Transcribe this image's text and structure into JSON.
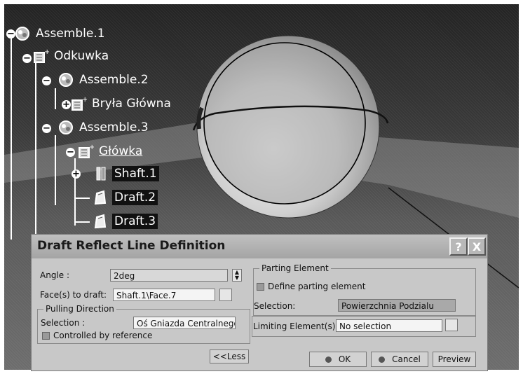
{
  "tree": {
    "nodes": [
      {
        "label": "Assemble.1",
        "icon": "assembly-icon"
      },
      {
        "label": "Odkuwka",
        "icon": "part-body-icon"
      },
      {
        "label": "Assemble.2",
        "icon": "assembly-icon"
      },
      {
        "label": "Bryła Główna",
        "icon": "part-body-icon"
      },
      {
        "label": "Assemble.3",
        "icon": "assembly-icon"
      },
      {
        "label": "Główka",
        "icon": "part-body-icon"
      },
      {
        "label": "Shaft.1",
        "icon": "shaft-icon"
      },
      {
        "label": "Draft.2",
        "icon": "draft-icon"
      },
      {
        "label": "Draft.3",
        "icon": "draft-icon"
      }
    ]
  },
  "dialog": {
    "title": "Draft Reflect Line Definition",
    "help_button": "?",
    "close_button": "X",
    "angle_label": "Angle :",
    "angle_value": "2deg",
    "faces_label": "Face(s) to draft:",
    "faces_value": "Shaft.1\\Face.7",
    "pulling_direction": {
      "title": "Pulling Direction",
      "selection_label": "Selection :",
      "selection_value": "Oś Gniazda Centralnego",
      "controlled_label": "Controlled by reference"
    },
    "less_button": "<<Less",
    "parting_element": {
      "title": "Parting Element",
      "define_label": "Define parting element",
      "selection_label": "Selection:",
      "selection_value": "Powierzchnia Podzialu"
    },
    "limiting_label": "Limiting Element(s):",
    "limiting_value": "No selection",
    "ok_button": "OK",
    "cancel_button": "Cancel",
    "preview_button": "Preview"
  },
  "colors": {
    "dialog_background": "#c8c8c8",
    "highlight": "#111111"
  }
}
